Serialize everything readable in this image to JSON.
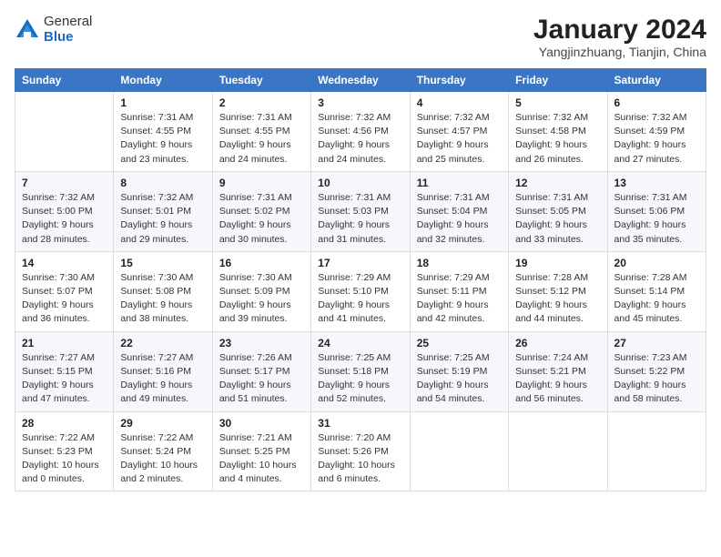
{
  "logo": {
    "general": "General",
    "blue": "Blue"
  },
  "header": {
    "month": "January 2024",
    "location": "Yangjinzhuang, Tianjin, China"
  },
  "weekdays": [
    "Sunday",
    "Monday",
    "Tuesday",
    "Wednesday",
    "Thursday",
    "Friday",
    "Saturday"
  ],
  "weeks": [
    [
      {
        "day": "",
        "info": ""
      },
      {
        "day": "1",
        "info": "Sunrise: 7:31 AM\nSunset: 4:55 PM\nDaylight: 9 hours\nand 23 minutes."
      },
      {
        "day": "2",
        "info": "Sunrise: 7:31 AM\nSunset: 4:55 PM\nDaylight: 9 hours\nand 24 minutes."
      },
      {
        "day": "3",
        "info": "Sunrise: 7:32 AM\nSunset: 4:56 PM\nDaylight: 9 hours\nand 24 minutes."
      },
      {
        "day": "4",
        "info": "Sunrise: 7:32 AM\nSunset: 4:57 PM\nDaylight: 9 hours\nand 25 minutes."
      },
      {
        "day": "5",
        "info": "Sunrise: 7:32 AM\nSunset: 4:58 PM\nDaylight: 9 hours\nand 26 minutes."
      },
      {
        "day": "6",
        "info": "Sunrise: 7:32 AM\nSunset: 4:59 PM\nDaylight: 9 hours\nand 27 minutes."
      }
    ],
    [
      {
        "day": "7",
        "info": "Sunrise: 7:32 AM\nSunset: 5:00 PM\nDaylight: 9 hours\nand 28 minutes."
      },
      {
        "day": "8",
        "info": "Sunrise: 7:32 AM\nSunset: 5:01 PM\nDaylight: 9 hours\nand 29 minutes."
      },
      {
        "day": "9",
        "info": "Sunrise: 7:31 AM\nSunset: 5:02 PM\nDaylight: 9 hours\nand 30 minutes."
      },
      {
        "day": "10",
        "info": "Sunrise: 7:31 AM\nSunset: 5:03 PM\nDaylight: 9 hours\nand 31 minutes."
      },
      {
        "day": "11",
        "info": "Sunrise: 7:31 AM\nSunset: 5:04 PM\nDaylight: 9 hours\nand 32 minutes."
      },
      {
        "day": "12",
        "info": "Sunrise: 7:31 AM\nSunset: 5:05 PM\nDaylight: 9 hours\nand 33 minutes."
      },
      {
        "day": "13",
        "info": "Sunrise: 7:31 AM\nSunset: 5:06 PM\nDaylight: 9 hours\nand 35 minutes."
      }
    ],
    [
      {
        "day": "14",
        "info": "Sunrise: 7:30 AM\nSunset: 5:07 PM\nDaylight: 9 hours\nand 36 minutes."
      },
      {
        "day": "15",
        "info": "Sunrise: 7:30 AM\nSunset: 5:08 PM\nDaylight: 9 hours\nand 38 minutes."
      },
      {
        "day": "16",
        "info": "Sunrise: 7:30 AM\nSunset: 5:09 PM\nDaylight: 9 hours\nand 39 minutes."
      },
      {
        "day": "17",
        "info": "Sunrise: 7:29 AM\nSunset: 5:10 PM\nDaylight: 9 hours\nand 41 minutes."
      },
      {
        "day": "18",
        "info": "Sunrise: 7:29 AM\nSunset: 5:11 PM\nDaylight: 9 hours\nand 42 minutes."
      },
      {
        "day": "19",
        "info": "Sunrise: 7:28 AM\nSunset: 5:12 PM\nDaylight: 9 hours\nand 44 minutes."
      },
      {
        "day": "20",
        "info": "Sunrise: 7:28 AM\nSunset: 5:14 PM\nDaylight: 9 hours\nand 45 minutes."
      }
    ],
    [
      {
        "day": "21",
        "info": "Sunrise: 7:27 AM\nSunset: 5:15 PM\nDaylight: 9 hours\nand 47 minutes."
      },
      {
        "day": "22",
        "info": "Sunrise: 7:27 AM\nSunset: 5:16 PM\nDaylight: 9 hours\nand 49 minutes."
      },
      {
        "day": "23",
        "info": "Sunrise: 7:26 AM\nSunset: 5:17 PM\nDaylight: 9 hours\nand 51 minutes."
      },
      {
        "day": "24",
        "info": "Sunrise: 7:25 AM\nSunset: 5:18 PM\nDaylight: 9 hours\nand 52 minutes."
      },
      {
        "day": "25",
        "info": "Sunrise: 7:25 AM\nSunset: 5:19 PM\nDaylight: 9 hours\nand 54 minutes."
      },
      {
        "day": "26",
        "info": "Sunrise: 7:24 AM\nSunset: 5:21 PM\nDaylight: 9 hours\nand 56 minutes."
      },
      {
        "day": "27",
        "info": "Sunrise: 7:23 AM\nSunset: 5:22 PM\nDaylight: 9 hours\nand 58 minutes."
      }
    ],
    [
      {
        "day": "28",
        "info": "Sunrise: 7:22 AM\nSunset: 5:23 PM\nDaylight: 10 hours\nand 0 minutes."
      },
      {
        "day": "29",
        "info": "Sunrise: 7:22 AM\nSunset: 5:24 PM\nDaylight: 10 hours\nand 2 minutes."
      },
      {
        "day": "30",
        "info": "Sunrise: 7:21 AM\nSunset: 5:25 PM\nDaylight: 10 hours\nand 4 minutes."
      },
      {
        "day": "31",
        "info": "Sunrise: 7:20 AM\nSunset: 5:26 PM\nDaylight: 10 hours\nand 6 minutes."
      },
      {
        "day": "",
        "info": ""
      },
      {
        "day": "",
        "info": ""
      },
      {
        "day": "",
        "info": ""
      }
    ]
  ]
}
